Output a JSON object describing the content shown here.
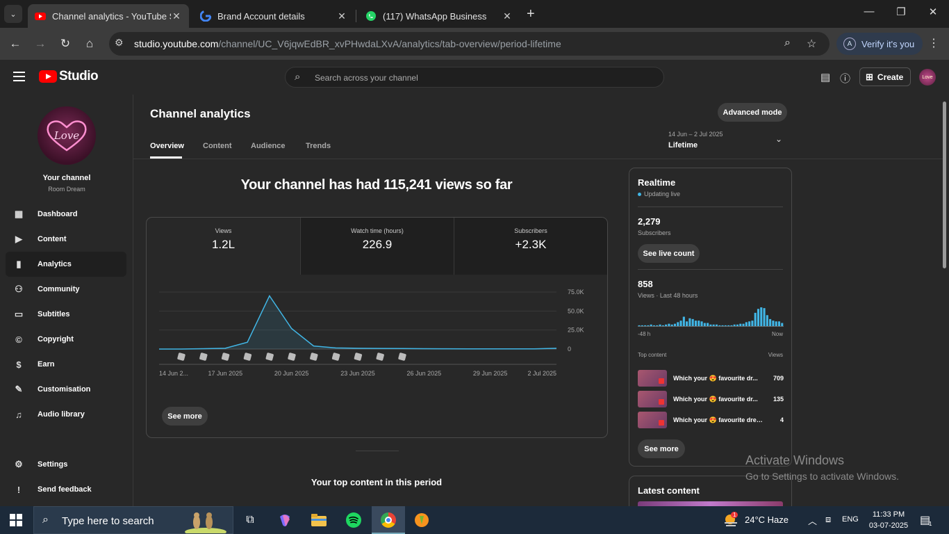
{
  "browser": {
    "tabs": [
      {
        "title": "Channel analytics - YouTube Studio",
        "active": true
      },
      {
        "title": "Brand Account details",
        "active": false
      },
      {
        "title": "(117) WhatsApp Business",
        "active": false
      }
    ],
    "url_host": "studio.youtube.com",
    "url_path": "/channel/UC_V6jqwEdBR_xvPHwdaLXvA/analytics/tab-overview/period-lifetime",
    "verify_label": "Verify it's you",
    "verify_avatar": "A"
  },
  "studio": {
    "logo_text": "Studio",
    "search_placeholder": "Search across your channel",
    "create_label": "Create",
    "avatar_text": "Love"
  },
  "sidebar": {
    "channel_label": "Your channel",
    "channel_name": "Room Dream",
    "avatar_text": "Love",
    "items": [
      {
        "label": "Dashboard",
        "icon": "dashboard-icon"
      },
      {
        "label": "Content",
        "icon": "content-icon"
      },
      {
        "label": "Analytics",
        "icon": "analytics-icon",
        "active": true
      },
      {
        "label": "Community",
        "icon": "community-icon"
      },
      {
        "label": "Subtitles",
        "icon": "subtitles-icon"
      },
      {
        "label": "Copyright",
        "icon": "copyright-icon"
      },
      {
        "label": "Earn",
        "icon": "earn-icon"
      },
      {
        "label": "Customisation",
        "icon": "customisation-icon"
      },
      {
        "label": "Audio library",
        "icon": "audio-library-icon"
      }
    ],
    "settings_label": "Settings",
    "feedback_label": "Send feedback"
  },
  "main": {
    "title": "Channel analytics",
    "advanced_mode_label": "Advanced mode",
    "tabs": [
      "Overview",
      "Content",
      "Audience",
      "Trends"
    ],
    "period_range": "14 Jun – 2 Jul 2025",
    "period_value": "Lifetime",
    "headline": "Your channel has had 115,241 views so far",
    "metrics": [
      {
        "label": "Views",
        "value": "1.2L"
      },
      {
        "label": "Watch time (hours)",
        "value": "226.9"
      },
      {
        "label": "Subscribers",
        "value": "+2.3K"
      }
    ],
    "see_more_label": "See more",
    "top_content_heading": "Your top content in this period"
  },
  "chart_data": {
    "type": "area",
    "x_tick_labels": [
      "14 Jun 2...",
      "17 Jun 2025",
      "20 Jun 2025",
      "23 Jun 2025",
      "26 Jun 2025",
      "29 Jun 2025",
      "2 Jul 2025"
    ],
    "y_tick_labels": [
      "75.0K",
      "50.0K",
      "25.0K",
      "0"
    ],
    "ylim": [
      0,
      75000
    ],
    "x": [
      "14 Jun",
      "15 Jun",
      "16 Jun",
      "17 Jun",
      "18 Jun",
      "19 Jun",
      "20 Jun",
      "21 Jun",
      "22 Jun",
      "23 Jun",
      "24 Jun",
      "25 Jun",
      "26 Jun",
      "27 Jun",
      "28 Jun",
      "29 Jun",
      "30 Jun",
      "1 Jul",
      "2 Jul"
    ],
    "values": [
      0,
      0,
      500,
      1000,
      9000,
      70000,
      27000,
      4000,
      1500,
      1000,
      800,
      600,
      500,
      400,
      300,
      300,
      300,
      300,
      1000
    ],
    "annotations_count": 11,
    "grid": true,
    "color": "#41b6e6"
  },
  "realtime": {
    "title": "Realtime",
    "live_label": "Updating live",
    "subscribers_value": "2,279",
    "subscribers_label": "Subscribers",
    "see_live_label": "See live count",
    "views_value": "858",
    "views_label": "Views · Last 48 hours",
    "axis_start": "-48 h",
    "axis_end": "Now",
    "hourly_views": [
      1,
      1,
      1,
      1,
      2,
      1,
      1,
      2,
      1,
      2,
      3,
      2,
      3,
      5,
      7,
      12,
      6,
      10,
      9,
      7,
      7,
      6,
      4,
      4,
      2,
      2,
      2,
      1,
      1,
      1,
      1,
      1,
      2,
      2,
      3,
      3,
      5,
      6,
      7,
      17,
      22,
      24,
      23,
      14,
      9,
      7,
      6,
      6,
      4
    ],
    "top_content_label": "Top content",
    "top_views_label": "Views",
    "top_content": [
      {
        "title": "Which your 😍 favourite dr...",
        "views": "709"
      },
      {
        "title": "Which your 😍 favourite dr...",
        "views": "135"
      },
      {
        "title": "Which your 😍 favourite drea...",
        "views": "4"
      }
    ],
    "see_more_label": "See more",
    "latest_title": "Latest content"
  },
  "watermark": {
    "line1": "Activate Windows",
    "line2": "Go to Settings to activate Windows."
  },
  "taskbar": {
    "search_placeholder": "Type here to search",
    "weather": "24°C  Haze",
    "weather_badge": "1",
    "language": "ENG",
    "time": "11:33 PM",
    "date": "03-07-2025",
    "notification_count": "1"
  }
}
